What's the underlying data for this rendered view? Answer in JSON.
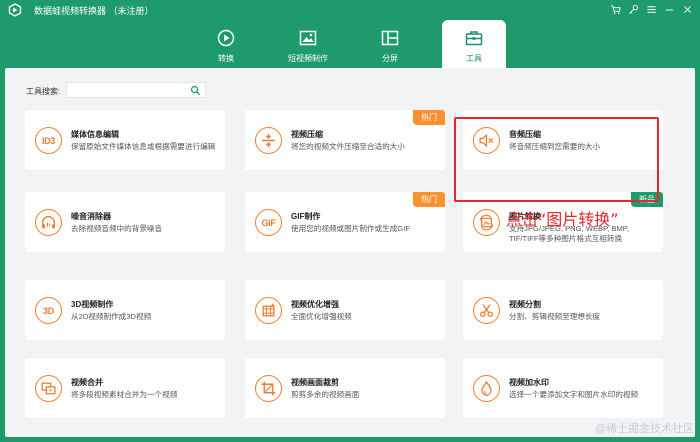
{
  "window": {
    "title": "数据蛙视频转换器 （未注册）",
    "controls": [
      "cart-icon",
      "key-icon",
      "menu-icon",
      "minimize-icon",
      "close-icon"
    ]
  },
  "tabs": [
    {
      "label": "转换",
      "icon": "convert-icon",
      "active": false
    },
    {
      "label": "短视频制作",
      "icon": "image-icon",
      "active": false
    },
    {
      "label": "分屏",
      "icon": "split-screen-icon",
      "active": false
    },
    {
      "label": "工具",
      "icon": "toolbox-icon",
      "active": true
    }
  ],
  "search": {
    "label": "工具搜索:",
    "value": "",
    "placeholder": ""
  },
  "tools": [
    {
      "title": "媒体信息编辑",
      "desc": "保留原始文件媒体信息或根据需要进行编辑",
      "icon": "id3-icon",
      "icon_text": "ID3",
      "badge": ""
    },
    {
      "title": "视频压缩",
      "desc": "将您的视频文件压缩至合适的大小",
      "icon": "compress-icon",
      "badge": "热门"
    },
    {
      "title": "音频压缩",
      "desc": "将音频压缩到您需要的大小",
      "icon": "audio-compress-icon",
      "badge": ""
    },
    {
      "title": "噪音消除器",
      "desc": "去除视频音频中的背景噪音",
      "icon": "headphone-icon",
      "badge": ""
    },
    {
      "title": "GIF制作",
      "desc": "使用您的视频或图片制作或生成GIF",
      "icon": "gif-icon",
      "icon_text": "GIF",
      "badge": "热门"
    },
    {
      "title": "图片转换",
      "desc": "支持JPG/JPEG, PNG, WEBP, BMP, TIF/TIFF等多种图片格式互相转换",
      "icon": "image-convert-icon",
      "badge": "新品"
    },
    {
      "title": "3D视频制作",
      "desc": "从2D视频制作成3D视频",
      "icon": "3d-icon",
      "icon_text": "3D",
      "badge": ""
    },
    {
      "title": "视频优化增强",
      "desc": "全面优化增强视频",
      "icon": "enhance-icon",
      "badge": ""
    },
    {
      "title": "视频分割",
      "desc": "分割、剪辑视频至理想长度",
      "icon": "scissors-icon",
      "badge": ""
    },
    {
      "title": "视频合并",
      "desc": "将多段视频素材合并为一个视频",
      "icon": "merge-icon",
      "badge": ""
    },
    {
      "title": "视频画面裁剪",
      "desc": "剪剪多余的视频画面",
      "icon": "crop-icon",
      "badge": ""
    },
    {
      "title": "视频加水印",
      "desc": "选择一个要添加文字和图片水印的视频",
      "icon": "watermark-icon",
      "badge": ""
    }
  ],
  "annotation": {
    "text": "点击“图片转换”"
  },
  "watermark": {
    "text": "@稀土掘金技术社区"
  },
  "colors": {
    "brand": "#1f9a6b",
    "accent": "#f37a2f",
    "hot_badge": "#f7922e",
    "highlight": "#e5262b"
  }
}
